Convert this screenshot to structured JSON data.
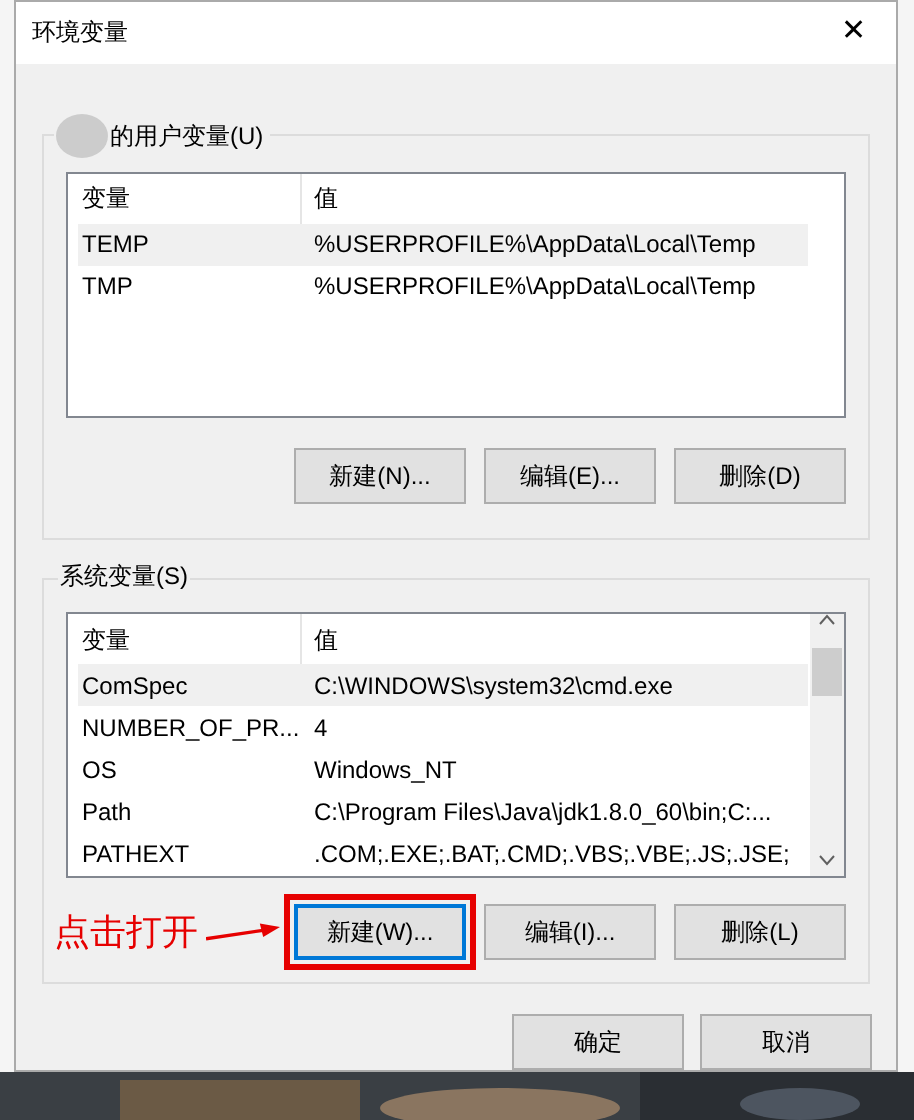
{
  "window": {
    "title": "环境变量",
    "close": "✕"
  },
  "user_variables": {
    "label": "的用户变量(U)",
    "columns": [
      "变量",
      "值"
    ],
    "rows": [
      {
        "name": "TEMP",
        "value": "%USERPROFILE%\\AppData\\Local\\Temp",
        "selected": true
      },
      {
        "name": "TMP",
        "value": "%USERPROFILE%\\AppData\\Local\\Temp",
        "selected": false
      }
    ],
    "buttons": [
      {
        "label": "新建(N)...",
        "focused": false
      },
      {
        "label": "编辑(E)...",
        "focused": false
      },
      {
        "label": "删除(D)",
        "focused": false
      }
    ]
  },
  "system_variables": {
    "label": "系统变量(S)",
    "columns": [
      "变量",
      "值"
    ],
    "rows": [
      {
        "name": "ComSpec",
        "value": "C:\\WINDOWS\\system32\\cmd.exe",
        "selected": true
      },
      {
        "name": "NUMBER_OF_PR...",
        "value": "4",
        "selected": false
      },
      {
        "name": "OS",
        "value": "Windows_NT",
        "selected": false
      },
      {
        "name": "Path",
        "value": "C:\\Program Files\\Java\\jdk1.8.0_60\\bin;C:...",
        "selected": false
      },
      {
        "name": "PATHEXT",
        "value": ".COM;.EXE;.BAT;.CMD;.VBS;.VBE;.JS;.JSE;",
        "selected": false
      }
    ],
    "buttons": [
      {
        "label": "新建(W)...",
        "focused": true
      },
      {
        "label": "编辑(I)...",
        "focused": false
      },
      {
        "label": "删除(L)",
        "focused": false
      }
    ]
  },
  "annotation": {
    "text": "点击打开"
  },
  "dialog_buttons": [
    {
      "label": "确定"
    },
    {
      "label": "取消"
    }
  ]
}
